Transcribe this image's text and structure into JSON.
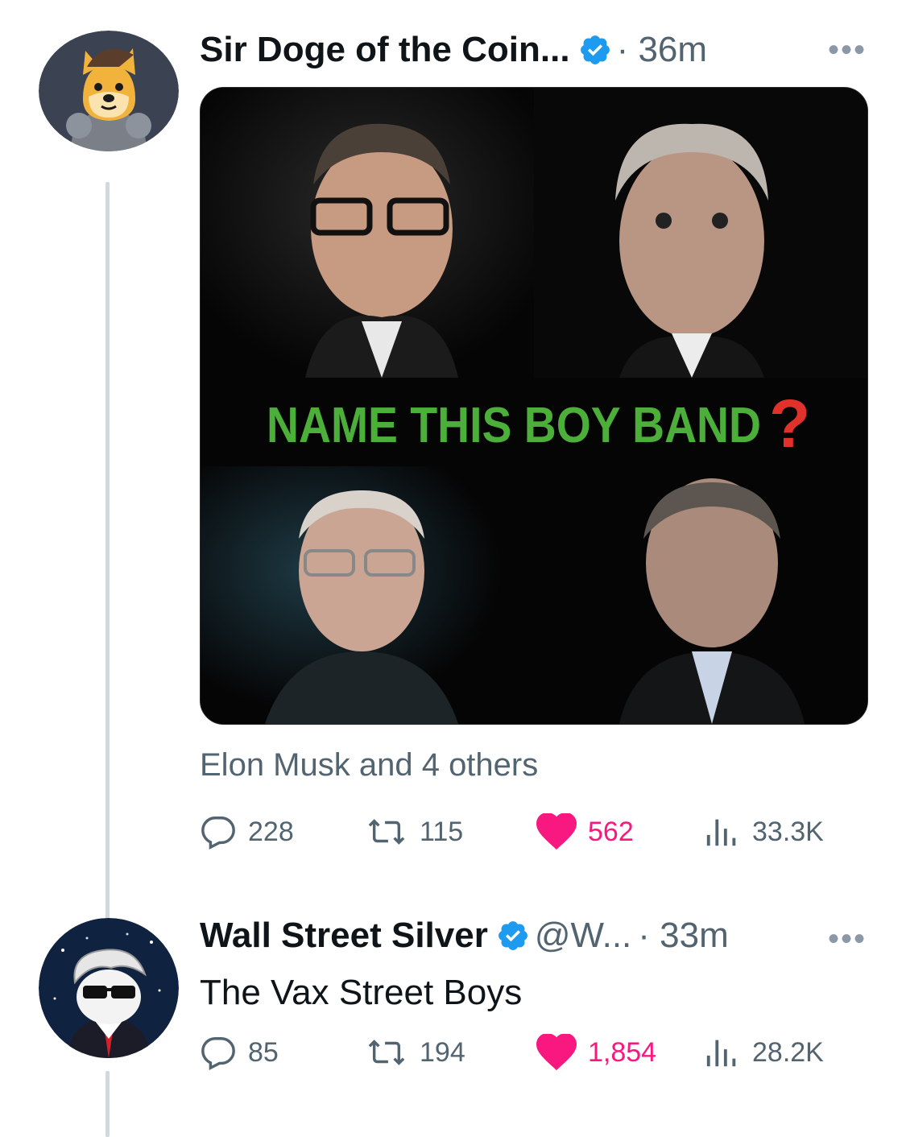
{
  "tweets": [
    {
      "author_name": "Sir Doge of the Coin...",
      "handle": "",
      "time": "· 36m",
      "image_caption_text": "NAME THIS BOY BAND",
      "image_caption_mark": "?",
      "social_context": "Elon Musk and 4 others",
      "stats": {
        "replies": "228",
        "retweets": "115",
        "likes": "562",
        "views": "33.3K"
      },
      "more": "•••"
    },
    {
      "author_name": "Wall Street Silver",
      "handle": "@W...",
      "time": "· 33m",
      "text": "The Vax Street Boys",
      "stats": {
        "replies": "85",
        "retweets": "194",
        "likes": "1,854",
        "views": "28.2K"
      },
      "more": "•••"
    }
  ],
  "colors": {
    "verified": "#1d9bf0",
    "like": "#f91880",
    "muted": "#536471",
    "thread": "#cfd9de",
    "caption_green": "#4caf3a",
    "caption_red": "#e0322b"
  },
  "icons": [
    "verified-badge-icon",
    "reply-icon",
    "retweet-icon",
    "heart-icon",
    "views-icon",
    "more-icon"
  ]
}
